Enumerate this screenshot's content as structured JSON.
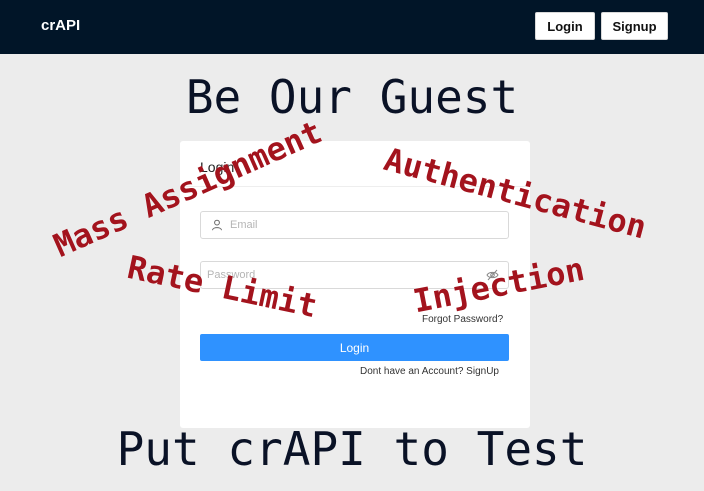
{
  "header": {
    "brand": "crAPI",
    "login_label": "Login",
    "signup_label": "Signup"
  },
  "headlines": {
    "top": "Be Our Guest",
    "bottom": "Put crAPI to Test"
  },
  "login_form": {
    "title": "Login",
    "email_placeholder": "Email",
    "email_icon": "user-icon",
    "password_placeholder": "Password",
    "password_icon": "eye-invisible-icon",
    "forgot_password": "Forgot Password?",
    "submit_label": "Login",
    "signup_prompt": "Dont have an Account? SignUp"
  },
  "overlay_words": {
    "mass_assignment": "Mass Assignment",
    "authentication": "Authentication",
    "rate_limit": "Rate Limit",
    "injection": "Injection"
  },
  "colors": {
    "header_bg": "#011528",
    "accent": "#2f92ff",
    "overlay_text": "#a3131d"
  }
}
